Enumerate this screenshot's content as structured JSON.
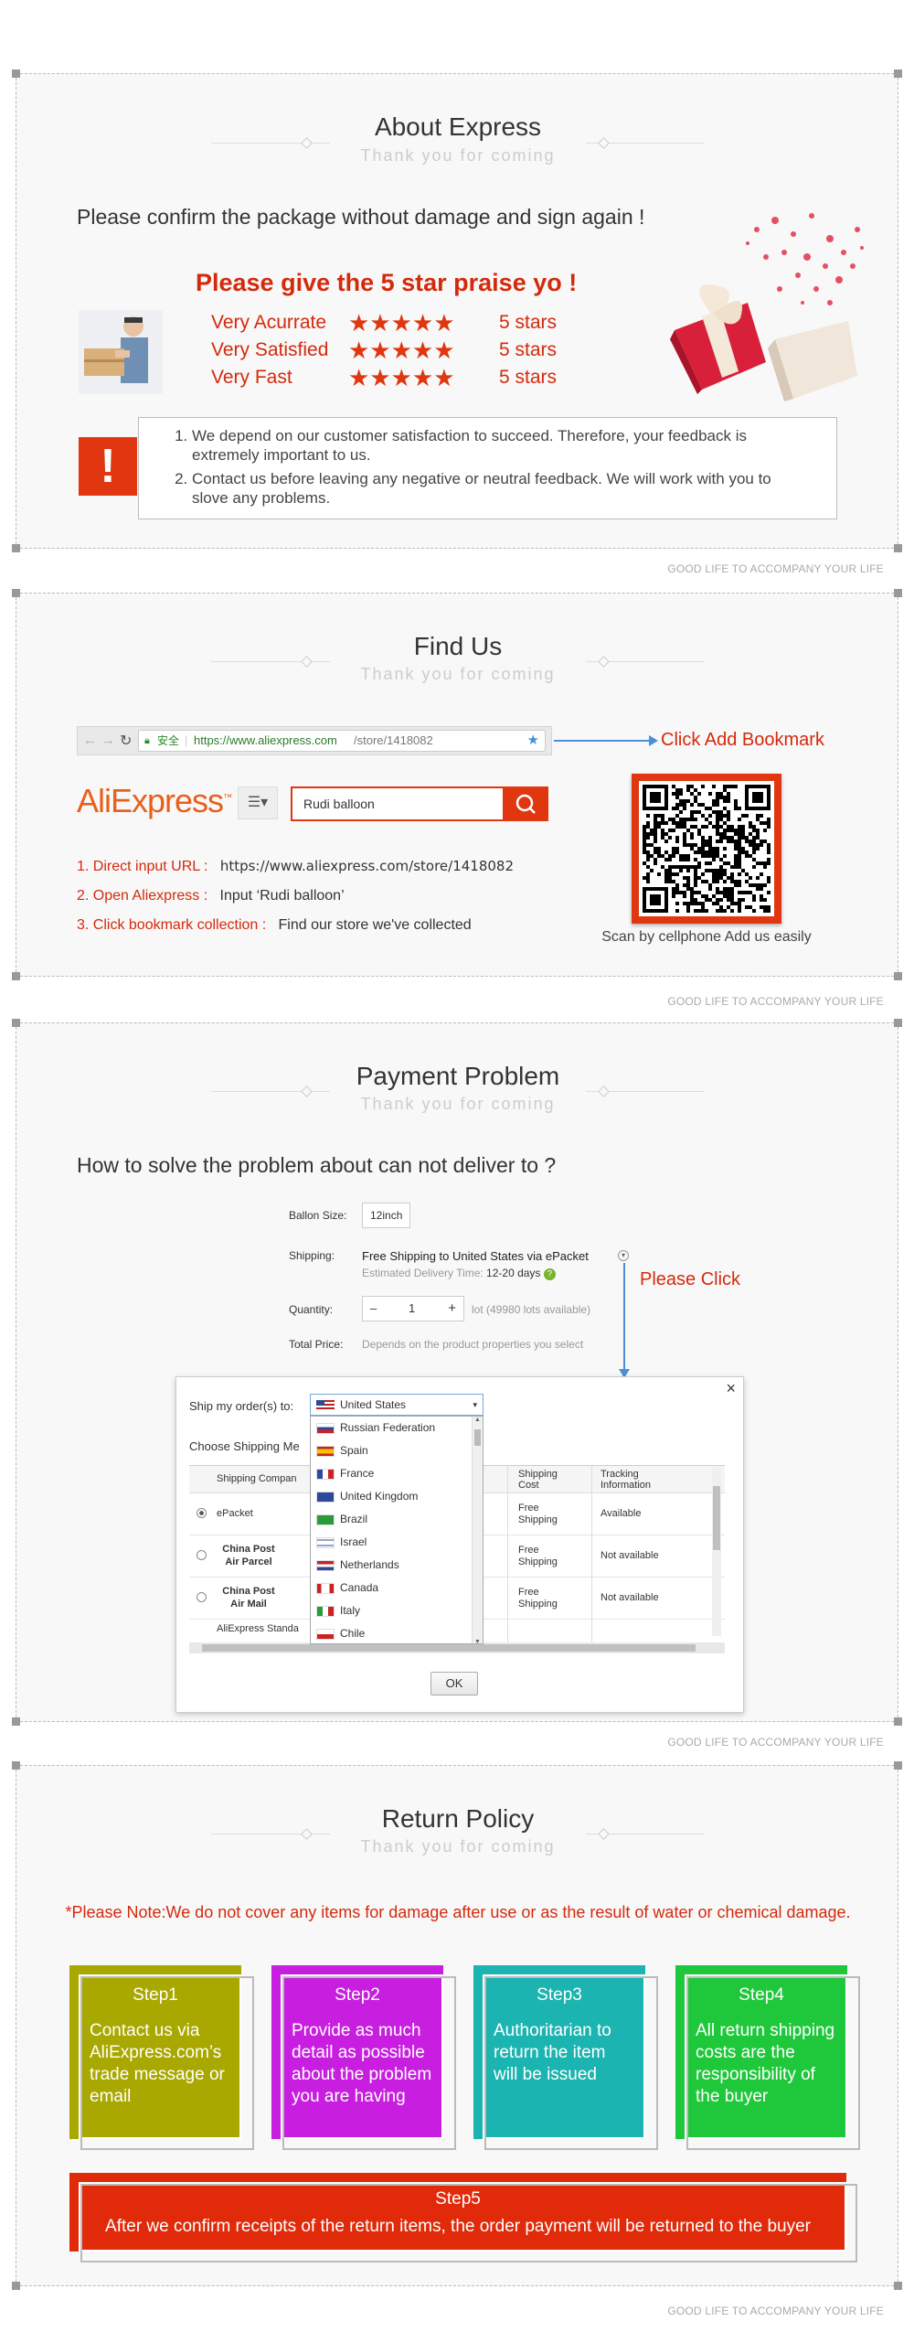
{
  "section_about": {
    "title": "About Express",
    "subtitle": "Thank you for coming",
    "confirm_text": "Please confirm the package without damage and sign again !",
    "praise_text": "Please give the 5 star praise yo !",
    "ratings": [
      {
        "label": "Very Acurrate",
        "value": "5 stars"
      },
      {
        "label": "Very Satisfied",
        "value": "5 stars"
      },
      {
        "label": "Very Fast",
        "value": "5 stars"
      }
    ],
    "notes": [
      "We depend on our customer satisfaction to succeed. Therefore, your feedback is extremely important to us.",
      "Contact us before leaving any negative or neutral feedback. We will work with you to slove any problems."
    ],
    "alert_glyph": "!"
  },
  "footer_text": "GOOD LIFE TO ACCOMPANY YOUR LIFE",
  "section_find": {
    "title": "Find Us",
    "subtitle": "Thank you for coming",
    "secure_label": "安全",
    "url_prefix": "https://www.aliexpress.com",
    "url_path": "/store/1418082",
    "bookmark_callout": "Click Add Bookmark",
    "logo": "AliExpress",
    "logo_tm": "™",
    "search_value": "Rudi balloon",
    "steps": [
      {
        "label": "1. Direct input URL :",
        "value": "https://www.aliexpress.com/store/1418082"
      },
      {
        "label": "2. Open Aliexpress :",
        "value": "Input ‘Rudi balloon’"
      },
      {
        "label": "3. Click bookmark collection :",
        "value": "Find our store we've collected"
      }
    ],
    "qr_caption": "Scan by cellphone Add us easily"
  },
  "section_payment": {
    "title": "Payment Problem",
    "subtitle": "Thank you for coming",
    "question": "How to solve the problem about can not deliver to ?",
    "ballon_size_label": "Ballon Size:",
    "ballon_size_value": "12inch",
    "shipping_label": "Shipping:",
    "shipping_value": "Free Shipping to United States via ePacket",
    "delivery_label": "Estimated Delivery Time:",
    "delivery_value": "12-20 days",
    "please_click": "Please Click",
    "quantity_label": "Quantity:",
    "quantity_value": "1",
    "quantity_minus": "–",
    "quantity_plus": "+",
    "quantity_note": "lot (49980 lots available)",
    "total_label": "Total Price:",
    "total_note": "Depends on the product properties you select",
    "dialog": {
      "close": "×",
      "ship_to_label": "Ship my order(s) to:",
      "selected_country": "United States",
      "choose_method_label": "Choose Shipping Me",
      "countries": [
        "Russian Federation",
        "Spain",
        "France",
        "United Kingdom",
        "Brazil",
        "Israel",
        "Netherlands",
        "Canada",
        "Italy",
        "Chile"
      ],
      "columns": [
        "Shipping Compan",
        "Shipping Cost",
        "Tracking Information"
      ],
      "rows": [
        {
          "company": "ePacket",
          "cost": "Free Shipping",
          "tracking": "Available"
        },
        {
          "company": "China Post Air Parcel",
          "cost": "Free Shipping",
          "tracking": "Not available"
        },
        {
          "company": "China Post Air Mail",
          "cost": "Free Shipping",
          "tracking": "Not available"
        },
        {
          "company": "AliExpress Standa",
          "cost": "",
          "tracking": ""
        }
      ],
      "ok": "OK"
    }
  },
  "section_return": {
    "title": "Return Policy",
    "subtitle": "Thank you for coming",
    "note": "*Please Note:We do not cover  any items for damage after use or as the result of water or chemical damage.",
    "steps": [
      {
        "title": "Step1",
        "body": "Contact us via AliExpress.com’s trade message or email",
        "color": "#a8a800"
      },
      {
        "title": "Step2",
        "body": "Provide as much detail as possible about the problem you are having",
        "color": "#c81ee0"
      },
      {
        "title": "Step3",
        "body": "Authoritarian to return the item will be issued",
        "color": "#1cb4b0"
      },
      {
        "title": "Step4",
        "body": "All return shipping costs are the responsibility of the buyer",
        "color": "#1ec83a"
      }
    ],
    "step5_title": "Step5",
    "step5_body": "After we confirm receipts of the return items, the order payment will be returned to the buyer",
    "step5_color": "#e02a0a"
  },
  "colors": {
    "accent_red": "#d42a0c",
    "link_blue": "#4a90d9",
    "panel_bg": "#f8f8f8"
  }
}
